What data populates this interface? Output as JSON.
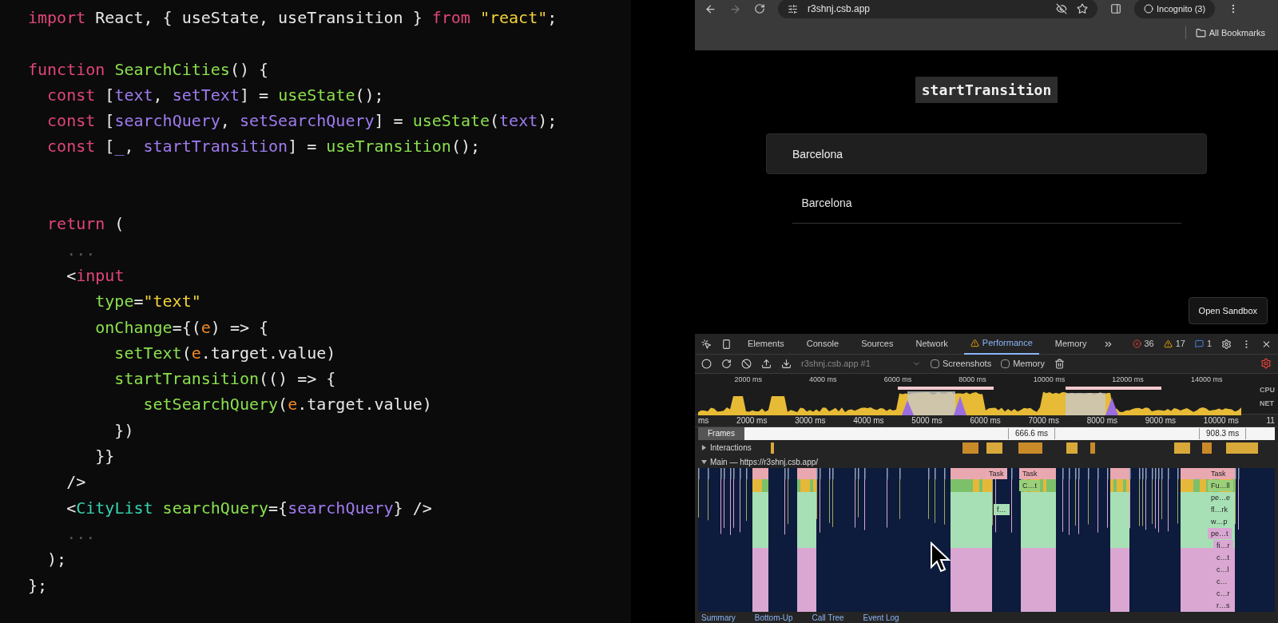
{
  "code": {
    "lines": [
      {
        "kind": "code",
        "tokens": [
          {
            "text": "import",
            "kind": "keyword"
          },
          {
            "text": " React, { useState, useTransition } ",
            "kind": "plain"
          },
          {
            "text": "from",
            "kind": "keyword"
          },
          {
            "text": " \"react\"",
            "kind": "string"
          },
          {
            "text": ";",
            "kind": "plain"
          }
        ]
      },
      {
        "kind": "blank"
      },
      {
        "kind": "code",
        "tokens": [
          {
            "text": "function ",
            "kind": "keyword"
          },
          {
            "text": "SearchCities",
            "kind": "func"
          },
          {
            "text": "() {",
            "kind": "plain"
          }
        ]
      },
      {
        "kind": "code",
        "tokens": [
          {
            "text": "  const",
            "kind": "keyword"
          },
          {
            "text": " [",
            "kind": "plain"
          },
          {
            "text": "text",
            "kind": "var"
          },
          {
            "text": ", ",
            "kind": "plain"
          },
          {
            "text": "setText",
            "kind": "var"
          },
          {
            "text": "] = ",
            "kind": "plain"
          },
          {
            "text": "useState",
            "kind": "func"
          },
          {
            "text": "();",
            "kind": "plain"
          }
        ]
      },
      {
        "kind": "code",
        "tokens": [
          {
            "text": "  const",
            "kind": "keyword"
          },
          {
            "text": " [",
            "kind": "plain"
          },
          {
            "text": "searchQuery",
            "kind": "var"
          },
          {
            "text": ", ",
            "kind": "plain"
          },
          {
            "text": "setSearchQuery",
            "kind": "var"
          },
          {
            "text": "] = ",
            "kind": "plain"
          },
          {
            "text": "useState",
            "kind": "func"
          },
          {
            "text": "(",
            "kind": "plain"
          },
          {
            "text": "text",
            "kind": "var"
          },
          {
            "text": ");",
            "kind": "plain"
          }
        ]
      },
      {
        "kind": "code",
        "tokens": [
          {
            "text": "  const",
            "kind": "keyword"
          },
          {
            "text": " [",
            "kind": "plain"
          },
          {
            "text": "_",
            "kind": "var"
          },
          {
            "text": ", ",
            "kind": "plain"
          },
          {
            "text": "startTransition",
            "kind": "var"
          },
          {
            "text": "] = ",
            "kind": "plain"
          },
          {
            "text": "useTransition",
            "kind": "func"
          },
          {
            "text": "();",
            "kind": "plain"
          }
        ]
      },
      {
        "kind": "blank"
      },
      {
        "kind": "blank"
      },
      {
        "kind": "code",
        "tokens": [
          {
            "text": "  return",
            "kind": "keyword"
          },
          {
            "text": " (",
            "kind": "plain"
          }
        ]
      },
      {
        "kind": "code",
        "tokens": [
          {
            "text": "    ...",
            "kind": "dim"
          }
        ]
      },
      {
        "kind": "code",
        "tokens": [
          {
            "text": "    <",
            "kind": "plain"
          },
          {
            "text": "input",
            "kind": "keyword"
          }
        ]
      },
      {
        "kind": "code",
        "tokens": [
          {
            "text": "       type",
            "kind": "func"
          },
          {
            "text": "=",
            "kind": "plain"
          },
          {
            "text": "\"text\"",
            "kind": "string"
          }
        ]
      },
      {
        "kind": "code",
        "tokens": [
          {
            "text": "       onChange",
            "kind": "func"
          },
          {
            "text": "={(",
            "kind": "plain"
          },
          {
            "text": "e",
            "kind": "param"
          },
          {
            "text": ") => {",
            "kind": "plain"
          }
        ]
      },
      {
        "kind": "code",
        "tokens": [
          {
            "text": "         setText",
            "kind": "func"
          },
          {
            "text": "(",
            "kind": "plain"
          },
          {
            "text": "e",
            "kind": "param"
          },
          {
            "text": ".target.value)",
            "kind": "plain"
          }
        ]
      },
      {
        "kind": "code",
        "tokens": [
          {
            "text": "         startTransition",
            "kind": "func"
          },
          {
            "text": "(() => {",
            "kind": "plain"
          }
        ]
      },
      {
        "kind": "code",
        "tokens": [
          {
            "text": "            setSearchQuery",
            "kind": "func"
          },
          {
            "text": "(",
            "kind": "plain"
          },
          {
            "text": "e",
            "kind": "param"
          },
          {
            "text": ".target.value)",
            "kind": "plain"
          }
        ]
      },
      {
        "kind": "code",
        "tokens": [
          {
            "text": "         })",
            "kind": "plain"
          }
        ]
      },
      {
        "kind": "code",
        "tokens": [
          {
            "text": "       }}",
            "kind": "plain"
          }
        ]
      },
      {
        "kind": "code",
        "tokens": [
          {
            "text": "    />",
            "kind": "plain"
          }
        ]
      },
      {
        "kind": "code",
        "tokens": [
          {
            "text": "    <",
            "kind": "plain"
          },
          {
            "text": "CityList ",
            "kind": "component"
          },
          {
            "text": "searchQuery",
            "kind": "func"
          },
          {
            "text": "={",
            "kind": "plain"
          },
          {
            "text": "searchQuery",
            "kind": "var"
          },
          {
            "text": "} />",
            "kind": "plain"
          }
        ]
      },
      {
        "kind": "code",
        "tokens": [
          {
            "text": "    ...",
            "kind": "dim"
          }
        ]
      },
      {
        "kind": "code",
        "tokens": [
          {
            "text": "  );",
            "kind": "plain"
          }
        ]
      },
      {
        "kind": "code",
        "tokens": [
          {
            "text": "};",
            "kind": "plain"
          }
        ]
      }
    ]
  },
  "browser": {
    "url": "r3shnj.csb.app",
    "profile": "Incognito (3)",
    "bookmarks": "All Bookmarks"
  },
  "page": {
    "heading": "startTransition",
    "search": {
      "value": "Barcelona"
    },
    "results": [
      "Barcelona"
    ],
    "button": "Open Sandbox"
  },
  "devtools": {
    "tabs": [
      {
        "label": "Elements",
        "selected": false,
        "warning": false
      },
      {
        "label": "Console",
        "selected": false,
        "warning": false
      },
      {
        "label": "Sources",
        "selected": false,
        "warning": false
      },
      {
        "label": "Network",
        "selected": false,
        "warning": false
      },
      {
        "label": "Performance",
        "selected": true,
        "warning": true
      },
      {
        "label": "Memory",
        "selected": false,
        "warning": false
      }
    ],
    "errors": "36",
    "warnings": "17",
    "messages": "1",
    "target": "r3shnj.csb.app #1",
    "checkboxes": [
      {
        "label": "Screenshots",
        "checked": false
      },
      {
        "label": "Memory",
        "checked": false
      }
    ],
    "overview_ticks": [
      "2000 ms",
      "4000 ms",
      "6000 ms",
      "8000 ms",
      "10000 ms",
      "12000 ms",
      "14000 ms"
    ],
    "overview_labels": [
      "CPU",
      "NET"
    ],
    "ruler_ticks": [
      "ms",
      "2000 ms",
      "3000 ms",
      "4000 ms",
      "5000 ms",
      "6000 ms",
      "7000 ms",
      "8000 ms",
      "9000 ms",
      "10000 ms",
      "11"
    ],
    "tracks": {
      "frames": "Frames",
      "frame_labels": [
        "666.6 ms",
        "908.3 ms"
      ],
      "interactions": {
        "label": "Interactions",
        "expanded": false
      },
      "main": {
        "label": "Main — https://r3shnj.csb.app/",
        "expanded": true
      }
    },
    "flame_labels": [
      "Task",
      "Task",
      "C…t",
      "f…",
      "Task",
      "Fu…ll",
      "pe…e",
      "fl…rk",
      "w…p",
      "pe…t",
      "fi…r",
      "c…t",
      "c…l",
      "c…",
      "c…r",
      "r…s"
    ],
    "bottom_tabs": [
      "Summary",
      "Bottom-Up",
      "Call Tree",
      "Event Log"
    ]
  }
}
